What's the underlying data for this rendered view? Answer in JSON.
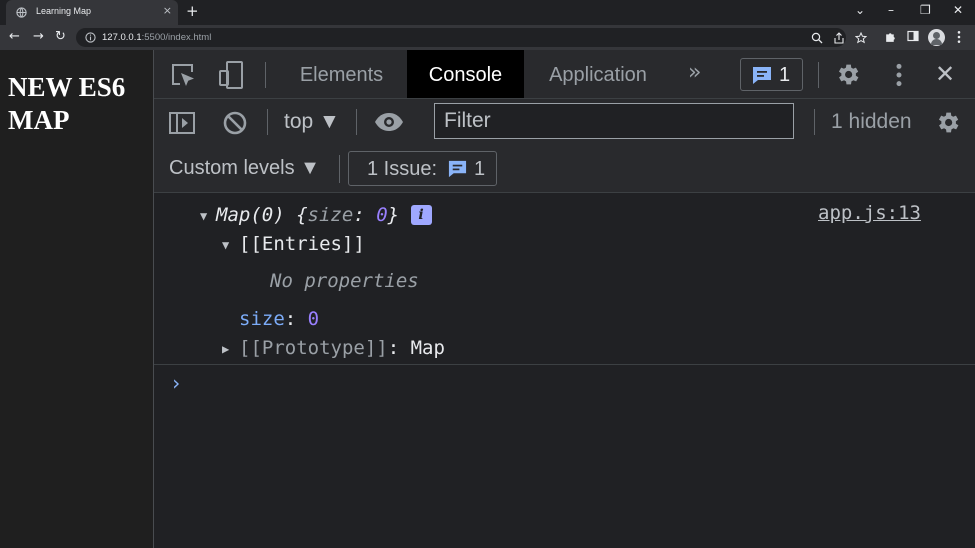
{
  "browser": {
    "tab_title": "Learning Map",
    "tab_close": "×",
    "new_tab": "+",
    "window_controls": {
      "caret": "⌄",
      "minimize": "–",
      "restore": "❐",
      "close": "✕"
    },
    "nav": {
      "back": "←",
      "forward": "→",
      "reload": "↻"
    },
    "url_host": "127.0.0.1",
    "url_rest": ":5500/index.html"
  },
  "page": {
    "heading": "NEW ES6 MAP"
  },
  "devtools": {
    "tabs": [
      "Elements",
      "Console",
      "Application"
    ],
    "active_tab": "Console",
    "more_tabs": "»",
    "issues_badge_count": "1",
    "close": "✕",
    "context": "top ▼",
    "filter_placeholder": "Filter",
    "hidden": "1 hidden",
    "levels": "Custom levels ▼",
    "issues_label": "1 Issue:",
    "issues_count": "1",
    "accent_color": "#8ab4f8"
  },
  "console": {
    "map_label": "Map(0)",
    "map_preview_open": "{",
    "map_preview_key": "size",
    "map_preview_colon": ": ",
    "map_preview_val": "0",
    "map_preview_close": "}",
    "info": "i",
    "source": "app.js:13",
    "entries_label": "[[Entries]]",
    "no_properties": "No properties",
    "size_key": "size",
    "size_colon": ": ",
    "size_value": "0",
    "prototype_label": "[[Prototype]]",
    "prototype_colon": ": ",
    "prototype_value": "Map",
    "prompt": "›"
  }
}
